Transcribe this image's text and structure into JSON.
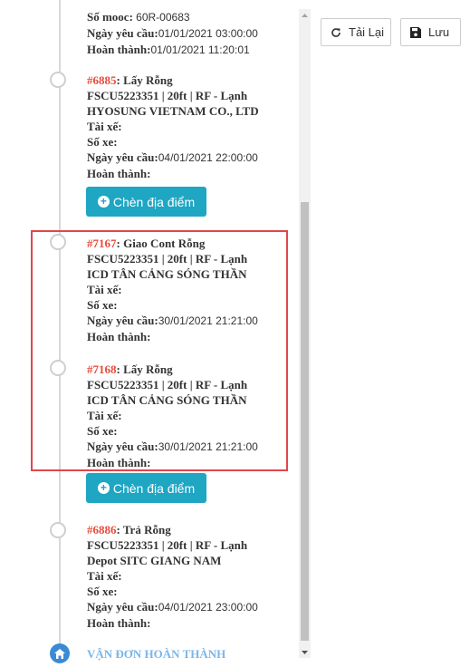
{
  "labels": {
    "so_mooc": "Số mooc:",
    "ngay_yeu_cau": "Ngày yêu cầu:",
    "hoan_thanh": "Hoàn thành:",
    "tai_xe": "Tài xế:",
    "so_xe": "Số xe:"
  },
  "top_item": {
    "so_mooc_value": "60R-00683",
    "ngay_yeu_cau_value": "01/01/2021 03:00:00",
    "hoan_thanh_value": "01/01/2021 11:20:01"
  },
  "items": [
    {
      "code": "#6885",
      "action": ": Lấy Rỗng",
      "container": "FSCU5223351 | 20ft | RF - Lạnh",
      "location": "HYOSUNG VIETNAM CO., LTD",
      "ngay_yeu_cau_value": "04/01/2021 22:00:00"
    },
    {
      "code": "#7167",
      "action": ": Giao Cont Rỗng",
      "container": "FSCU5223351 | 20ft | RF - Lạnh",
      "location": "ICD TÂN CẢNG SÓNG THẦN",
      "ngay_yeu_cau_value": "30/01/2021 21:21:00"
    },
    {
      "code": "#7168",
      "action": ": Lấy Rỗng",
      "container": "FSCU5223351 | 20ft | RF - Lạnh",
      "location": "ICD TÂN CẢNG SÓNG THẦN",
      "ngay_yeu_cau_value": "30/01/2021 21:21:00"
    },
    {
      "code": "#6886",
      "action": ": Trả Rỗng",
      "container": "FSCU5223351 | 20ft | RF - Lạnh",
      "location": "Depot SITC GIANG NAM",
      "ngay_yeu_cau_value": "04/01/2021 23:00:00"
    }
  ],
  "insert_button_label": "Chèn địa điểm",
  "complete_label": "VẬN ĐƠN HOÀN THÀNH",
  "toolbar": {
    "reload_label": "Tải Lại",
    "save_label": "Lưu"
  },
  "icons": {
    "reload": "refresh-icon",
    "save": "floppy-disk-icon",
    "insert": "plus-circle-icon",
    "complete": "home-icon"
  },
  "colors": {
    "accent": "#1ea6c3",
    "code_red": "#e74c3c",
    "highlight_border": "#e0474c",
    "complete_text": "#7bb6e8"
  }
}
